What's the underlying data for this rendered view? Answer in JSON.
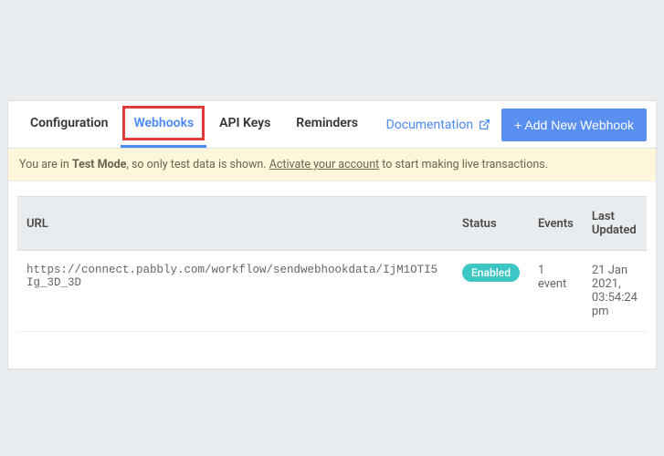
{
  "tabs": {
    "configuration": "Configuration",
    "webhooks": "Webhooks",
    "api_keys": "API Keys",
    "reminders": "Reminders"
  },
  "actions": {
    "documentation": "Documentation",
    "add_webhook": "+ Add New Webhook"
  },
  "notice": {
    "prefix": "You are in ",
    "mode": "Test Mode",
    "middle": ", so only test data is shown. ",
    "link": "Activate your account",
    "suffix": " to start making live transactions."
  },
  "table": {
    "headers": {
      "url": "URL",
      "status": "Status",
      "events": "Events",
      "last_updated": "Last Updated"
    },
    "rows": [
      {
        "url": "https://connect.pabbly.com/workflow/sendwebhookdata/IjM1OTI5Ig_3D_3D",
        "status": "Enabled",
        "events": "1 event",
        "last_updated": "21 Jan 2021, 03:54:24 pm"
      }
    ]
  }
}
